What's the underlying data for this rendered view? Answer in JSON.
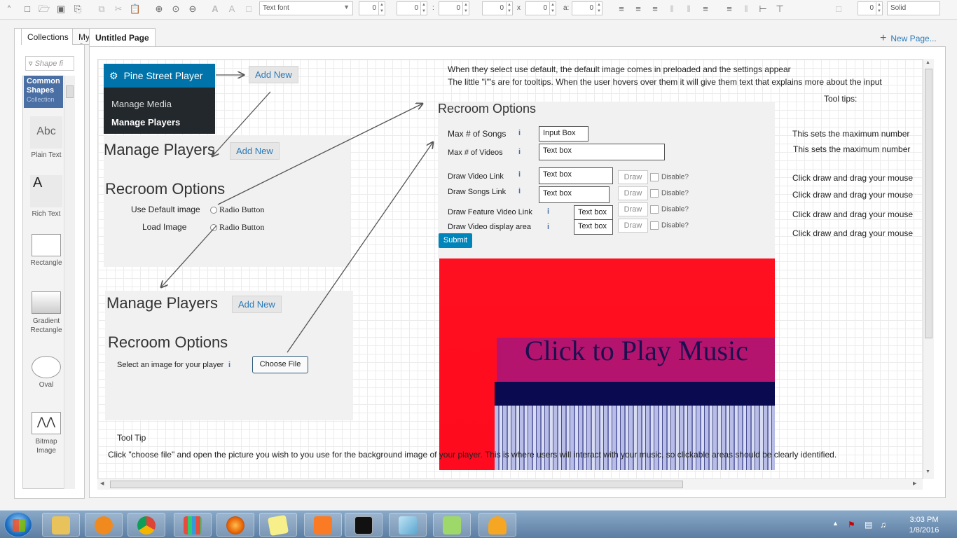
{
  "toolbar": {
    "font_placeholder": "Text font",
    "font_size": "0",
    "x_value": "0",
    "y_value": "0",
    "w_value": "0",
    "h_value": "0",
    "angle_value": "0",
    "separator_colon": ":",
    "separator_x": "x",
    "separator_a": "a:",
    "line_width": "0",
    "line_style": "Solid"
  },
  "left_panel": {
    "tab_collections": "Collections",
    "tab_my": "My St",
    "search_placeholder": "Shape fi",
    "common_shapes": "Common Shapes",
    "common_sub": "Collection",
    "shapes": [
      {
        "label": "Plain Text",
        "glyph": "Abc"
      },
      {
        "label": "Rich Text",
        "glyph": "A"
      },
      {
        "label": "Rectangle"
      },
      {
        "label": "Gradient Rectangle"
      },
      {
        "label": "Oval"
      },
      {
        "label": "Bitmap Image"
      }
    ]
  },
  "page": {
    "tab_title": "Untitled Page",
    "new_page": "New Page..."
  },
  "canvas": {
    "wp_menu_title": "Pine Street Player",
    "wp_menu_item1": "Manage Media",
    "wp_menu_item2": "Manage Players",
    "add_new": "Add New",
    "manage_players": "Manage Players",
    "recroom_options": "Recroom Options",
    "use_default_image": "Use Default image",
    "load_image": "Load Image",
    "radio_button": "Radio Button",
    "select_image": "Select an image for your player",
    "choose_file": "Choose File",
    "tool_tip_heading": "Tool Tip",
    "tool_tip_text": "Click \"choose file\" and open the picture you wish to you use for the background image of your player. This is where users will interact with your music, so clickable areas should be clearly identified.",
    "note_line1": "When they select use default, the default image comes in preloaded and the settings appear",
    "note_line2": "The little \"i\"'s are for tooltips. When the user hovers over them it will give them text that explains more about the input",
    "tooltips_heading": "Tool tips:",
    "tooltip_max": "This sets the maximum number",
    "tooltip_draw": "Click draw and drag your mouse",
    "rows": [
      {
        "label": "Max # of Songs",
        "value": "Input Box"
      },
      {
        "label": "Max # of Videos",
        "value": "Text box"
      },
      {
        "label": "Draw Video Link",
        "value": "Text box",
        "draw": "Draw",
        "disable": "Disable?"
      },
      {
        "label": "Draw Songs Link",
        "value": "Text box",
        "draw": "Draw",
        "disable": "Disable?"
      },
      {
        "label": "Draw Feature Video Link",
        "value": "Text box",
        "draw": "Draw",
        "disable": "Disable?"
      },
      {
        "label": "Draw Video display area",
        "value": "Text box",
        "draw": "Draw",
        "disable": "Disable?"
      }
    ],
    "submit": "Submit",
    "banner_text": "Click to Play Music"
  },
  "taskbar": {
    "time": "3:03 PM",
    "date": "1/8/2016"
  },
  "colors": {
    "wp_blue": "#0073aa",
    "wp_dark": "#23282d",
    "player_red": "#ff0a1e",
    "banner_magenta": "#b4146e",
    "banner_navy": "#0a0a50",
    "link_blue": "#2a7ab8"
  }
}
